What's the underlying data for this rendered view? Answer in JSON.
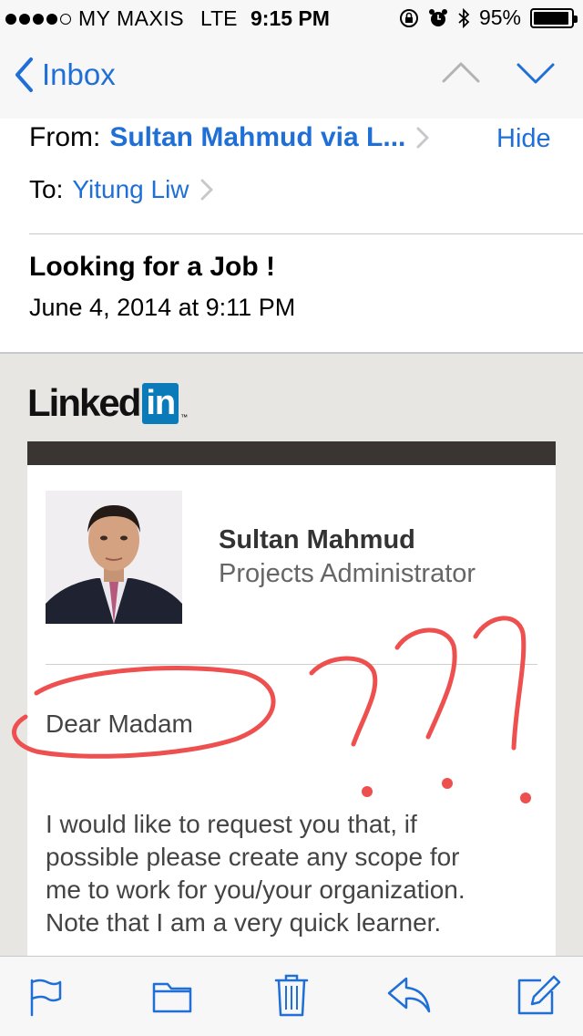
{
  "status_bar": {
    "carrier": "MY MAXIS",
    "network": "LTE",
    "time": "9:15 PM",
    "battery": "95%",
    "battery_level": 0.95,
    "signal_bars": 4
  },
  "nav": {
    "back_label": "Inbox",
    "icons": [
      "chevron-left-icon",
      "chevron-up-icon",
      "chevron-down-icon"
    ]
  },
  "header": {
    "from_label": "From:",
    "from_name": "Sultan Mahmud via L...",
    "hide_label": "Hide",
    "to_label": "To:",
    "to_name": "Yitung Liw",
    "subject": "Looking for a Job !",
    "date": "June 4, 2014 at 9:11 PM"
  },
  "email": {
    "logo_text": "Linked",
    "logo_badge": "in",
    "logo_tm": "™",
    "sender_name": "Sultan Mahmud",
    "sender_title": "Projects Administrator",
    "greeting": "Dear Madam",
    "paragraph_lines": [
      "I would like to request you that, if",
      "possible please create any scope for",
      "me to work for you/your organization.",
      "Note that I am a very quick learner."
    ]
  },
  "toolbar": {
    "icons": [
      "flag-icon",
      "folder-icon",
      "trash-icon",
      "reply-icon",
      "compose-icon"
    ]
  },
  "colors": {
    "ios_blue": "#1f6fd6",
    "linkedin_blue": "#0a7bb8",
    "annotation_red": "#ee4f4f",
    "bar_background": "#f7f7f7",
    "body_background": "#e8e6e3",
    "dark_band": "#3a3532"
  }
}
